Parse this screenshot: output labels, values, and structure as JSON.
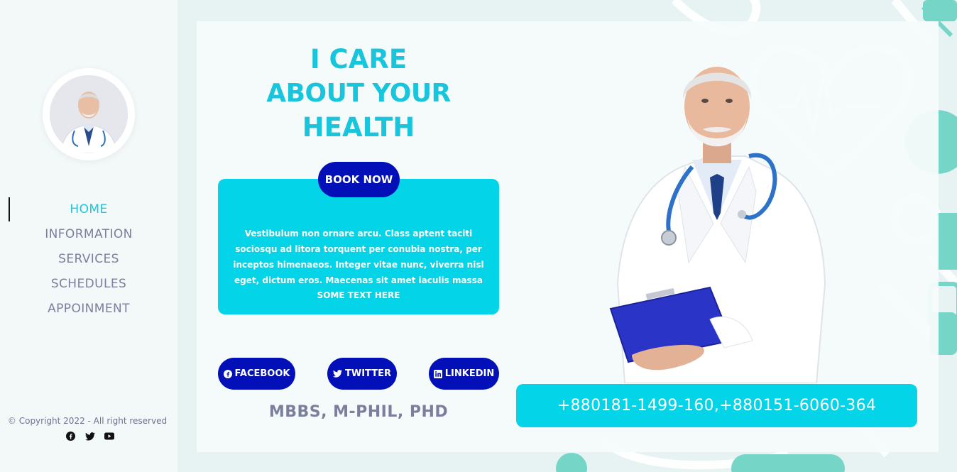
{
  "sidebar": {
    "nav": [
      "HOME",
      "INFORMATION",
      "SERVICES",
      "SCHEDULES",
      "APPOINMENT"
    ],
    "active_index": 0,
    "copyright": "© Copyright 2022 - All right reserved",
    "social_icons": [
      "facebook-icon",
      "twitter-icon",
      "youtube-icon"
    ]
  },
  "hero": {
    "title_lines": [
      "I CARE",
      "ABOUT YOUR",
      "HEALTH"
    ],
    "book_label": "BOOK NOW",
    "description": "Vestibulum non ornare arcu. Class aptent taciti sociosqu ad litora torquent per conubia nostra, per inceptos himenaeos. Integer vitae nunc, viverra nisl eget, dictum eros. Maecenas sit amet iaculis massa",
    "sub_text": "SOME TEXT HERE",
    "social_buttons": [
      "FACEBOOK",
      "TWITTER",
      "LINKEDIN"
    ],
    "degrees": "MBBS, M-PHIL, PHD",
    "phone": "+880181-1499-160,+880151-6060-364"
  },
  "colors": {
    "accent": "#03d4e7",
    "title": "#18c5dc",
    "button": "#0310b7",
    "muted_text": "#7b7f9d",
    "sidebar_bg": "#f3f9f9",
    "page_bg": "#e6f3f2"
  }
}
